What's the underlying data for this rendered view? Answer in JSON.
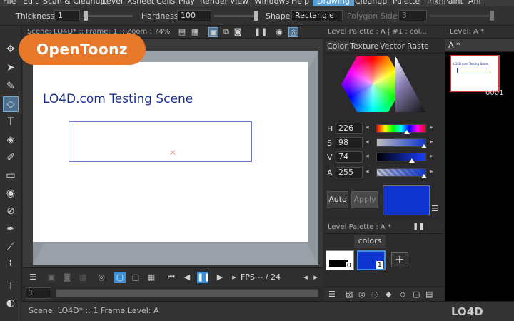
{
  "menu": {
    "items": [
      "File",
      "Edit",
      "Scan & Cleanup",
      "Level",
      "Xsheet",
      "Cells",
      "Play",
      "Render",
      "View",
      "Windows",
      "Help"
    ],
    "rooms": [
      "Drawing",
      "Cleanup",
      "Palette",
      "InknPaint",
      "Ani"
    ],
    "active_room": "Drawing"
  },
  "tool_options": {
    "thickness_label": "Thickness:",
    "thickness_value": "1",
    "hardness_label": "Hardness:",
    "hardness_value": "100",
    "shape_label": "Shape:",
    "shape_value": "Rectangle",
    "polygon_label": "Polygon Sides:",
    "polygon_value": "3"
  },
  "toolbar": {
    "tools": [
      "animate-tool",
      "selection-tool",
      "brush-tool",
      "geometric-tool",
      "type-tool",
      "fill-tool",
      "paint-brush-tool",
      "eraser-tool",
      "tape-tool",
      "style-picker-tool",
      "rgb-picker-tool",
      "control-point-editor-tool",
      "pinch-tool",
      "pump-tool",
      "magnet-tool"
    ],
    "selected": "geometric-tool"
  },
  "viewer": {
    "title": "Scene: LO4D*  ::  Frame: 1  ::  Zoom : 74%",
    "scene_text": "LO4D.com Testing Scene",
    "fps_text": "FPS -- / 24",
    "frame_value": "1"
  },
  "style_editor": {
    "title": "Level Palette : A | #1 : col...",
    "tabs": [
      "Color",
      "Texture",
      "Vector",
      "Raste"
    ],
    "active_tab": "Color",
    "channels": [
      {
        "name": "H",
        "value": "226"
      },
      {
        "name": "S",
        "value": "98"
      },
      {
        "name": "V",
        "value": "74"
      },
      {
        "name": "A",
        "value": "255"
      }
    ],
    "auto_label": "Auto",
    "apply_label": "Apply",
    "current_color": "#1034d0"
  },
  "level_palette": {
    "title": "Level Palette : A *",
    "page_tab": "colors",
    "styles": [
      {
        "index": "0",
        "color": "#000000"
      },
      {
        "index": "1",
        "color": "#1034d0"
      }
    ]
  },
  "level_strip": {
    "title": "Level:  A *",
    "selector": "A *",
    "frame_label": "0001"
  },
  "status": {
    "text": "Scene: LO4D*  ::  1 Frame  Level: A"
  },
  "branding": {
    "logo_text": "OpenToonz",
    "logo_color": "#e8782a",
    "watermark": "LO4D"
  }
}
